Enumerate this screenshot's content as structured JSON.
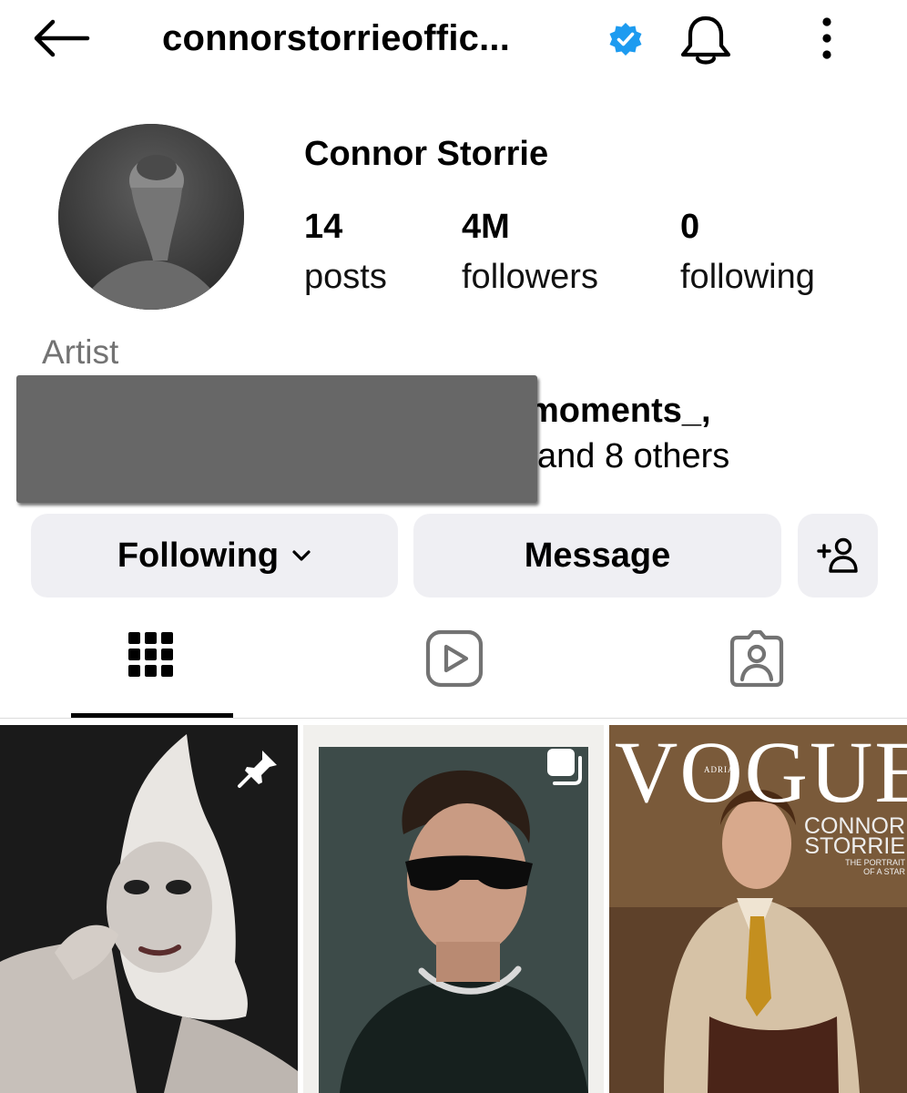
{
  "header": {
    "handle": "connorstorrieoffic...",
    "back_icon": "arrow-left-icon",
    "verified_icon": "verified-badge-icon",
    "bell_icon": "bell-icon",
    "menu_icon": "more-vertical-icon",
    "verified_color": "#1d9bf0"
  },
  "profile": {
    "name": "Connor Storrie",
    "stats": [
      {
        "value": "14",
        "label": "posts"
      },
      {
        "value": "4M",
        "label": "followers"
      },
      {
        "value": "0",
        "label": "following"
      }
    ],
    "category": "Artist",
    "mutual_line1": "moments_,",
    "mutual_line2": "and 8 others"
  },
  "actions": {
    "following_label": "Following",
    "message_label": "Message",
    "add_friend_icon": "add-person-icon"
  },
  "tabs": [
    {
      "name": "posts-grid",
      "icon": "grid-icon",
      "active": true
    },
    {
      "name": "reels",
      "icon": "reels-icon",
      "active": false
    },
    {
      "name": "tagged",
      "icon": "tagged-person-icon",
      "active": false
    }
  ],
  "grid": {
    "tile1": {
      "badge_icon": "pin-icon"
    },
    "tile2": {
      "badge_icon": "carousel-icon"
    },
    "tile3": {
      "masthead": "VOGUE",
      "sub": "ADRIA",
      "cover_line1": "CONNOR",
      "cover_line2": "STORRIE",
      "tagline1": "THE PORTRAIT",
      "tagline2": "OF A STAR"
    }
  }
}
